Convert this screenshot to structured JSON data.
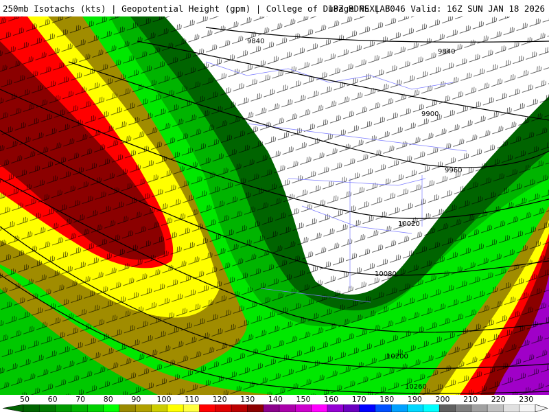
{
  "header": {
    "left": "250mb Isotachs (kts) | Geopotential Height (gpm) | College of DuPage NEXLAB",
    "right": "18Z RDPS | F046 Valid: 16Z SUN JAN 18 2026"
  },
  "contours": [
    {
      "label": "9840"
    },
    {
      "label": "9840"
    },
    {
      "label": "9900"
    },
    {
      "label": "9960"
    },
    {
      "label": "10020"
    },
    {
      "label": "10080"
    },
    {
      "label": "10200"
    },
    {
      "label": "10260"
    }
  ],
  "legend": {
    "labels": [
      "50",
      "60",
      "70",
      "80",
      "90",
      "100",
      "110",
      "120",
      "130",
      "140",
      "150",
      "160",
      "170",
      "180",
      "190",
      "200",
      "210",
      "220",
      "230"
    ],
    "colors": [
      "#006400",
      "#007a00",
      "#009a00",
      "#00b400",
      "#00d000",
      "#00ff00",
      "#998a00",
      "#b0a000",
      "#cccc00",
      "#ffff00",
      "#ffff40",
      "#ff0000",
      "#e00000",
      "#bb0000",
      "#8b0000",
      "#8b008b",
      "#aa00aa",
      "#cc00cc",
      "#ff00ff",
      "#9400d3",
      "#6a00c0",
      "#0000ff",
      "#0050ff",
      "#00a0ff",
      "#00d8ff",
      "#00ffff",
      "#606060",
      "#808080",
      "#a0a0a0",
      "#c0c0c0",
      "#e0e0e0",
      "#f4f4f4"
    ]
  },
  "colors": {
    "white": "#ffffff",
    "green_dark": "#006400",
    "green": "#00a000",
    "green_bright": "#00e800",
    "olive": "#a08c00",
    "yellow": "#ffff00",
    "red": "#ff0000",
    "dark_red": "#8b0000",
    "purple": "#a000c8"
  }
}
